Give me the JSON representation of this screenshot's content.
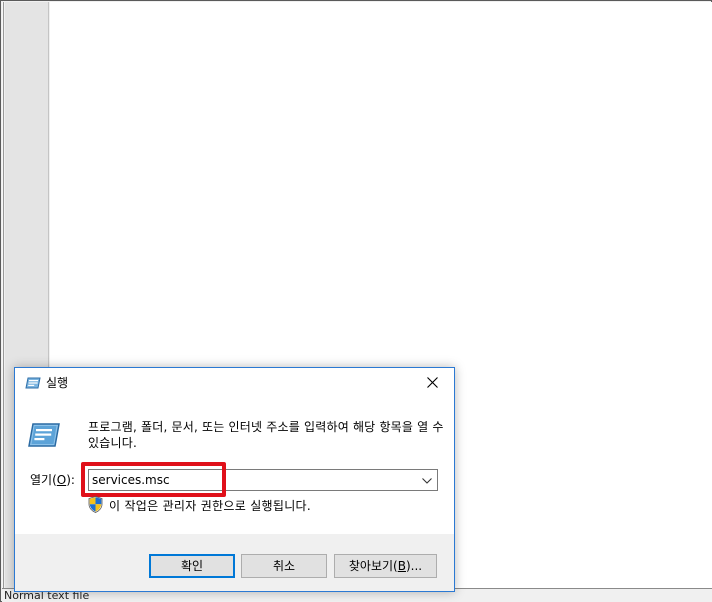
{
  "background": {
    "statusbar_text": "Normal text file"
  },
  "dialog": {
    "title": "실행",
    "description": "프로그램, 폴더, 문서, 또는 인터넷 주소를 입력하여 해당 항목을 열 수 있습니다.",
    "open_label_prefix": "열기(",
    "open_label_accel": "O",
    "open_label_suffix": "):",
    "input_value": "services.msc",
    "admin_note": "이 작업은 관리자 권한으로 실행됩니다.",
    "ok_label": "확인",
    "cancel_label": "취소",
    "browse_label_prefix": "찾아보기(",
    "browse_label_accel": "B",
    "browse_label_suffix": ")...",
    "icons": {
      "title": "run-icon",
      "main": "run-icon",
      "close": "close-icon",
      "dropdown": "chevron-down-icon",
      "shield": "uac-shield-icon"
    },
    "colors": {
      "accent": "#0078d7",
      "highlight": "#e0101a",
      "footer_bg": "#f0f0f0"
    }
  }
}
